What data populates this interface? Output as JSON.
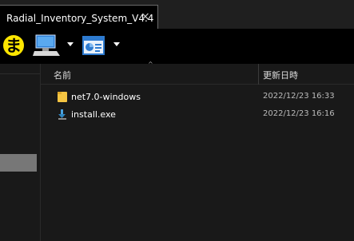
{
  "tab": {
    "title": "Radial_Inventory_System_V4.4",
    "close": "×"
  },
  "toolbar": {
    "app_icon_label": "ま",
    "app_icon_color": "#ffe600",
    "pc_icon": "computer-icon",
    "control_panel_icon": "control-panel-icon"
  },
  "columns": {
    "name": "名前",
    "date": "更新日時"
  },
  "files": [
    {
      "name": "net7.0-windows",
      "date": "2022/12/23 16:33",
      "icon": "folder-icon"
    },
    {
      "name": "install.exe",
      "date": "2022/12/23 16:16",
      "icon": "installer-icon"
    }
  ],
  "colors": {
    "background": "#191919",
    "toolbar": "#000000",
    "selected_nav": "#777777",
    "folder": "#f5c542"
  }
}
